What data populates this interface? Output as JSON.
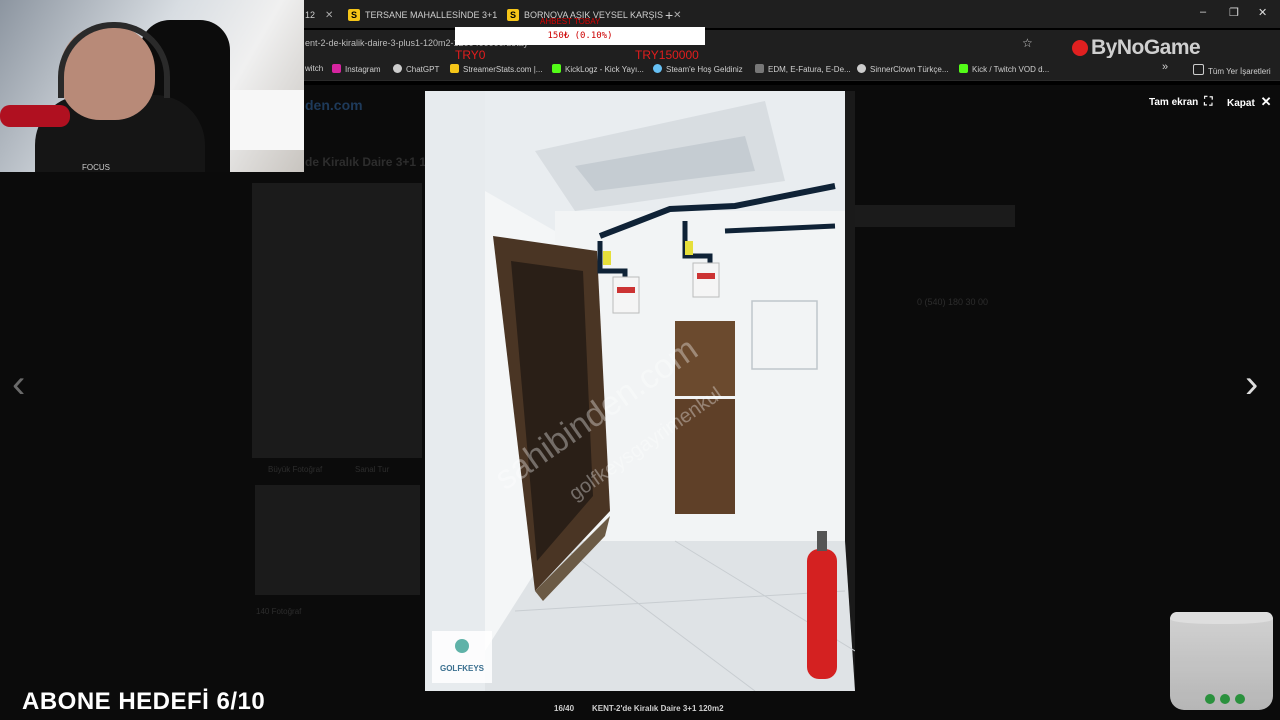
{
  "browser": {
    "tabs": [
      {
        "label": "12",
        "favicon": "S"
      },
      {
        "label": "TERSANE MAHALLESİNDE 3+1",
        "favicon": "S"
      },
      {
        "label": "BORNOVA AŞIK VEYSEL KARŞIS",
        "favicon": "S"
      }
    ],
    "new_tab": "+",
    "window": {
      "minimize": "‒",
      "maximize": "❐",
      "close": "✕"
    },
    "url": "ent-2-de-kiralik-daire-3-plus1-120m2-1200400000/detay",
    "bookmarks": [
      {
        "label": "witch",
        "color": "#9146ff"
      },
      {
        "label": "Instagram",
        "color": "#d6249f"
      },
      {
        "label": "ChatGPT",
        "color": "#cccccc"
      },
      {
        "label": "StreamerStats.com |...",
        "color": "#f5c518"
      },
      {
        "label": "KickLogz - Kick Yayı...",
        "color": "#53fc18"
      },
      {
        "label": "Steam'e Hoş Geldiniz",
        "color": "#1b2838"
      },
      {
        "label": "EDM, E-Fatura, E-De...",
        "color": "#cccccc"
      },
      {
        "label": "SinnerClown Türkçe...",
        "color": "#cccccc"
      },
      {
        "label": "Kick / Twitch VOD d...",
        "color": "#53fc18"
      }
    ],
    "bookmarks_more": "»",
    "all_bookmarks": "Tüm Yer İşaretleri",
    "extension_logo": "ByNoGame"
  },
  "donation": {
    "name": "AHBEST TOBAY",
    "amount": "150₺ (0.10%)",
    "left_total": "TRY0",
    "right_total": "TRY150000"
  },
  "gallery": {
    "fullscreen_label": "Tam ekran",
    "close_label": "Kapat",
    "counter": "16/40",
    "caption": "KENT-2'de Kiralık Daire 3+1 120m2",
    "watermark_1": "sahibinden.com",
    "watermark_2": "golfkeysgayrimenkul",
    "logo_text": "GOLFKEYS"
  },
  "background": {
    "site": "den.com",
    "title": "de Kiralık Daire 3+1 1",
    "photos_label": "Büyük Fotoğraf",
    "video_label": "Sanal Tur",
    "count_label": "140 Fotoğraf",
    "phone": "0 (540) 180 30 00"
  },
  "webcam": {
    "shirt_text": "FOCUS"
  },
  "stream": {
    "goal_text": "ABONE HEDEFİ 6/10"
  },
  "colors": {
    "accent_red": "#e31d1d",
    "tab_favicon": "#f5c518",
    "overlay_bg": "#000000"
  }
}
